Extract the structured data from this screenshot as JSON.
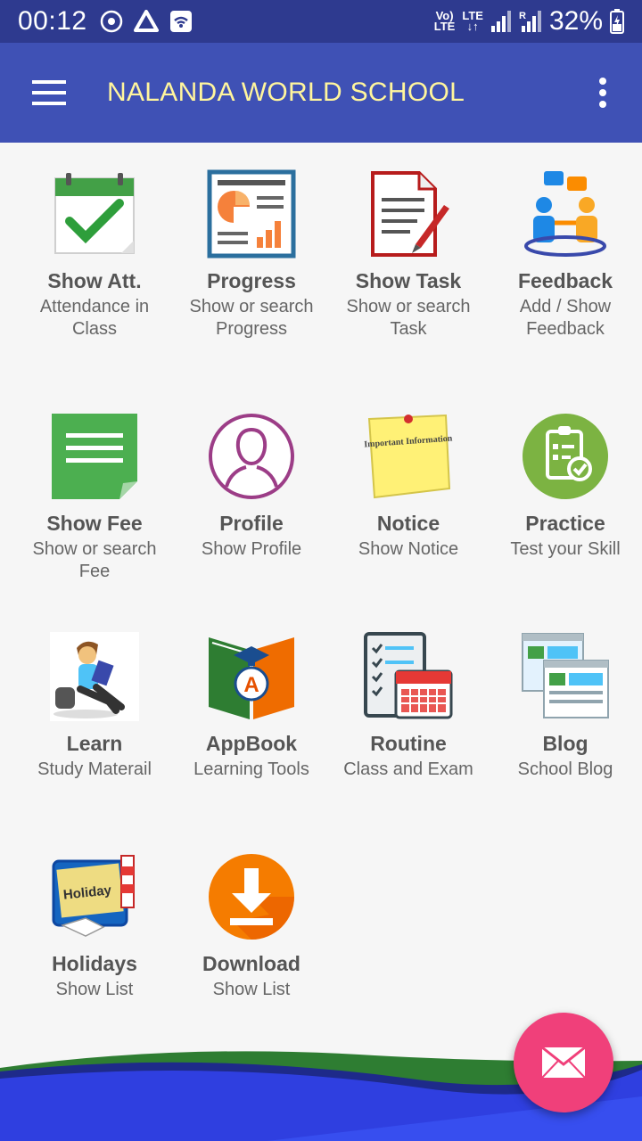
{
  "status_bar": {
    "time": "00:12",
    "net_top": "Vo)",
    "net_bottom": "LTE",
    "lte": "LTE",
    "battery": "32%"
  },
  "app_bar": {
    "title": "NALANDA WORLD SCHOOL"
  },
  "tiles": [
    {
      "label": "Show Att.",
      "sub": "Attendance in Class",
      "icon": "attendance-check-icon"
    },
    {
      "label": "Progress",
      "sub": "Show or search Progress",
      "icon": "progress-report-icon"
    },
    {
      "label": "Show Task",
      "sub": "Show or search Task",
      "icon": "task-document-icon"
    },
    {
      "label": "Feedback",
      "sub": "Add / Show Feedback",
      "icon": "feedback-people-icon"
    },
    {
      "label": "Show Fee",
      "sub": "Show or search Fee",
      "icon": "fee-note-icon"
    },
    {
      "label": "Profile",
      "sub": "Show Profile",
      "icon": "profile-user-icon"
    },
    {
      "label": "Notice",
      "sub": "Show Notice",
      "icon": "notice-sticky-icon",
      "note_text": "Important Information"
    },
    {
      "label": "Practice",
      "sub": "Test your Skill",
      "icon": "practice-clipboard-icon"
    },
    {
      "label": "Learn",
      "sub": "Study Materail",
      "icon": "learn-student-icon"
    },
    {
      "label": "AppBook",
      "sub": "Learning Tools",
      "icon": "appbook-icon"
    },
    {
      "label": "Routine",
      "sub": "Class and Exam",
      "icon": "routine-calendar-icon"
    },
    {
      "label": "Blog",
      "sub": "School Blog",
      "icon": "blog-pages-icon"
    },
    {
      "label": "Holidays",
      "sub": "Show List",
      "icon": "holidays-board-icon",
      "board_text": "Holiday"
    },
    {
      "label": "Download",
      "sub": "Show List",
      "icon": "download-icon"
    }
  ],
  "colors": {
    "status_bar": "#2e3a8f",
    "app_bar": "#3f51b5",
    "title_text": "#fff59d",
    "fab": "#f0407a"
  }
}
